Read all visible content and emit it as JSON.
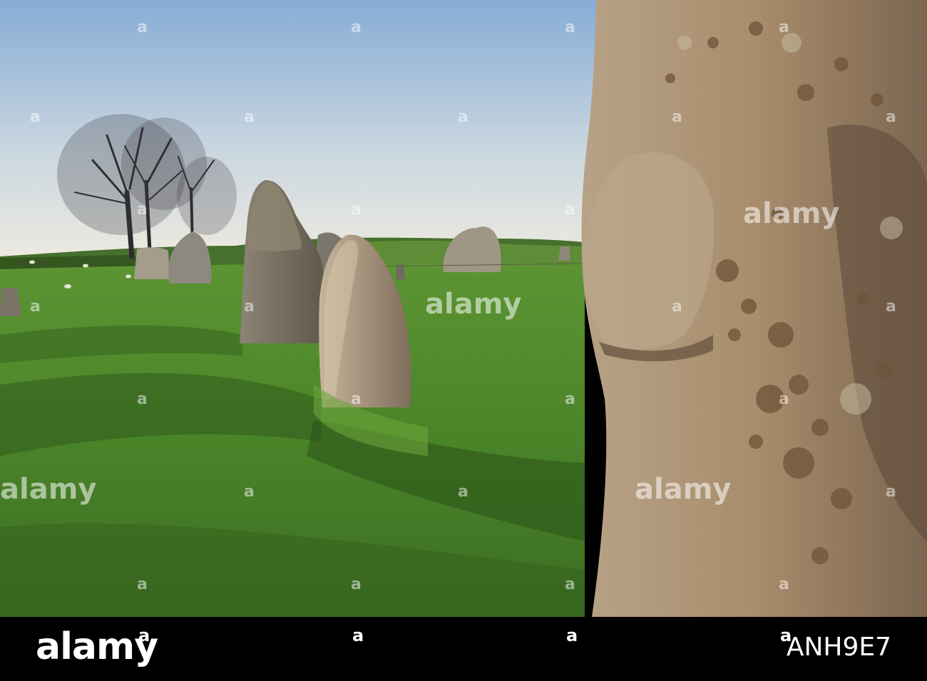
{
  "watermark": {
    "text": "alamy",
    "mark": "a"
  },
  "footer": {
    "brand": "alamy",
    "image_code": "ANH9E7",
    "dot_mark": "a"
  },
  "colors": {
    "sky_top": "#8fb3d8",
    "sky_bottom": "#f2eee4",
    "grass": "#4f8a2e",
    "stone": "#a58c6c"
  }
}
